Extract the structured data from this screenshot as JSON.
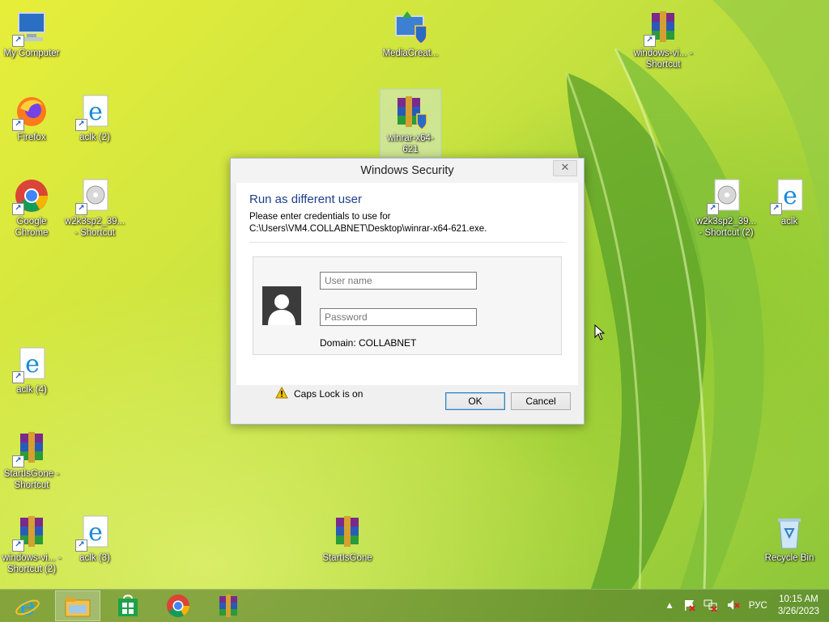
{
  "desktop": {
    "icons": [
      {
        "label": "My Computer",
        "icon": "computer-icon"
      },
      {
        "label": "Firefox",
        "icon": "firefox-icon"
      },
      {
        "label": "aclk (2)",
        "icon": "ie-icon"
      },
      {
        "label": "Google Chrome",
        "icon": "chrome-icon"
      },
      {
        "label": "w2k3sp2_39... - Shortcut",
        "icon": "disc-file-icon"
      },
      {
        "label": "aclk (4)",
        "icon": "ie-icon"
      },
      {
        "label": "StartIsGone - Shortcut",
        "icon": "winrar-icon"
      },
      {
        "label": "windows-vi... - Shortcut (2)",
        "icon": "winrar-icon"
      },
      {
        "label": "aclk (3)",
        "icon": "ie-icon"
      },
      {
        "label": "MediaCreat...",
        "icon": "media-creation-icon"
      },
      {
        "label": "winrar-x64-621",
        "icon": "winrar-installer-icon"
      },
      {
        "label": "StartIsGone",
        "icon": "winrar-icon"
      },
      {
        "label": "windows-vi... - Shortcut",
        "icon": "winrar-icon"
      },
      {
        "label": "w2k3sp2_39... - Shortcut (2)",
        "icon": "disc-file-icon"
      },
      {
        "label": "aclk",
        "icon": "ie-icon"
      },
      {
        "label": "Recycle Bin",
        "icon": "recycle-bin-icon"
      }
    ]
  },
  "dialog": {
    "title": "Windows Security",
    "close": "✕",
    "heading": "Run as different user",
    "line1": "Please enter credentials to use for",
    "line2": "C:\\Users\\VM4.COLLABNET\\Desktop\\winrar-x64-621.exe.",
    "username_placeholder": "User name",
    "password_placeholder": "Password",
    "domain": "Domain: COLLABNET",
    "caps_warning": "Caps Lock is on",
    "ok": "OK",
    "cancel": "Cancel"
  },
  "taskbar": {
    "apps": [
      "ie-icon",
      "file-explorer-icon",
      "store-icon",
      "chrome-icon",
      "winrar-icon"
    ],
    "language": "РУС",
    "time": "10:15 AM",
    "date": "3/26/2023"
  },
  "colors": {
    "accent": "#1e3f8c",
    "ok_border": "#3c7fb1"
  }
}
